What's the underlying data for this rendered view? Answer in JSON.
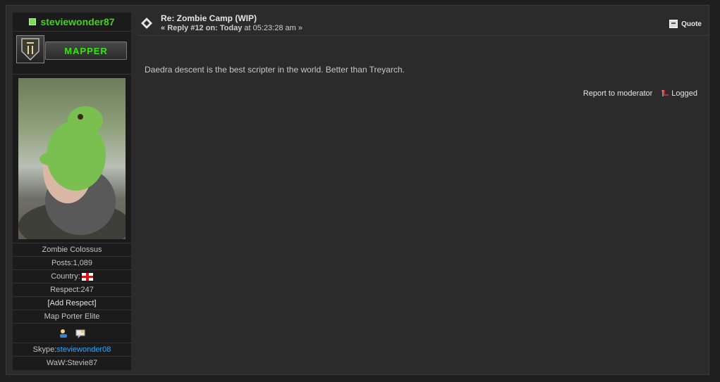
{
  "poster": {
    "username": "steviewonder87",
    "rank_label": "MAPPER",
    "emblem_icon": "call-of-duty-emblem-icon",
    "title": "Zombie Colossus",
    "posts_label": "Posts: ",
    "posts": "1,089",
    "country_label": "Country:",
    "country_flag_icon": "england-flag-icon",
    "respect_label": "Respect: ",
    "respect": "247",
    "add_respect": "[Add Respect]",
    "group": "Map Porter Elite",
    "profile_icon": "profile-icon",
    "message_icon": "message-icon",
    "skype_label": "Skype: ",
    "skype": "steviewonder08",
    "waw_label": "WaW: ",
    "waw": "Stevie87"
  },
  "post": {
    "subject": "Re: Zombie Camp (WIP)",
    "reply_prefix": "« ",
    "reply_number": "Reply #12 on:",
    "reply_day": "Today",
    "reply_time": " at 05:23:28 am »",
    "quote_label": "Quote",
    "body": "Daedra descent is the best scripter in the world. Better than Treyarch.",
    "report_label": "Report to moderator",
    "logged_label": "Logged"
  },
  "colors": {
    "username": "#45d21e",
    "rank": "#38e312",
    "link": "#2ea6ff",
    "background": "#2b2b2b"
  }
}
